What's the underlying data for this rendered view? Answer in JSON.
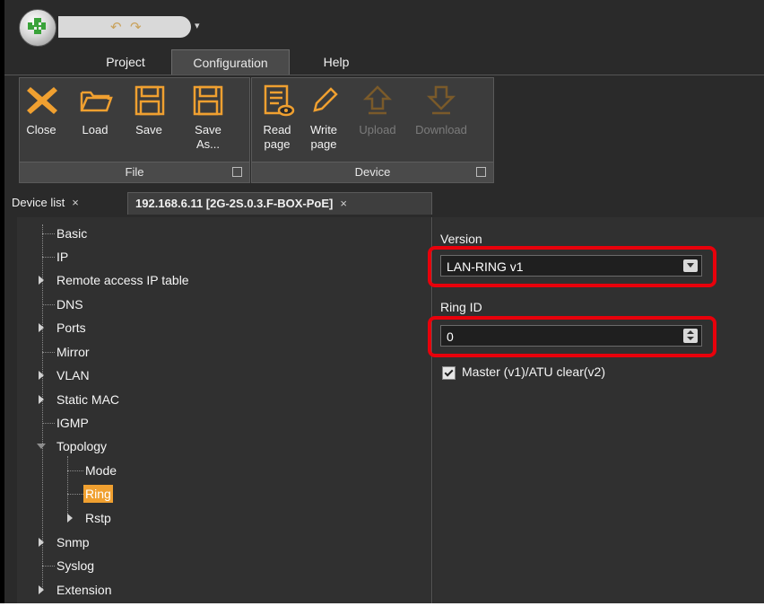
{
  "colors": {
    "accent": "#f0a030",
    "highlight": "#e8000b",
    "ribbon_icon": "#f0a030",
    "disabled": "#7b7b7b"
  },
  "menu": {
    "tabs": [
      {
        "label": "Project"
      },
      {
        "label": "Configuration"
      },
      {
        "label": "Help"
      }
    ]
  },
  "ribbon": {
    "file_group": {
      "label": "File",
      "buttons": [
        {
          "label": "Close",
          "icon": "close-icon"
        },
        {
          "label": "Load",
          "icon": "folder-icon"
        },
        {
          "label": "Save",
          "icon": "save-icon"
        },
        {
          "label": "Save As...",
          "icon": "save-as-icon"
        }
      ]
    },
    "device_group": {
      "label": "Device",
      "buttons": [
        {
          "label": "Read page",
          "icon": "read-page-icon"
        },
        {
          "label": "Write page",
          "icon": "write-page-icon"
        },
        {
          "label": "Upload",
          "icon": "upload-icon",
          "disabled": true
        },
        {
          "label": "Download",
          "icon": "download-icon",
          "disabled": true
        }
      ]
    }
  },
  "doc_tabs": [
    {
      "label": "Device list",
      "close": "×"
    },
    {
      "label": "192.168.6.11 [2G-2S.0.3.F-BOX-PoE]",
      "close": "×"
    }
  ],
  "tree": {
    "items": [
      {
        "label": "Basic"
      },
      {
        "label": "IP"
      },
      {
        "label": "Remote access IP table"
      },
      {
        "label": "DNS"
      },
      {
        "label": "Ports"
      },
      {
        "label": "Mirror"
      },
      {
        "label": "VLAN"
      },
      {
        "label": "Static MAC"
      },
      {
        "label": "IGMP"
      },
      {
        "label": "Topology"
      },
      {
        "label": "Mode"
      },
      {
        "label": "Ring",
        "selected": true
      },
      {
        "label": "Rstp"
      },
      {
        "label": "Snmp"
      },
      {
        "label": "Syslog"
      },
      {
        "label": "Extension"
      }
    ]
  },
  "props": {
    "version_label": "Version",
    "version_value": "LAN-RING v1",
    "ring_id_label": "Ring ID",
    "ring_id_value": "0",
    "master_label": "Master (v1)/ATU clear(v2)",
    "master_checked": true
  }
}
